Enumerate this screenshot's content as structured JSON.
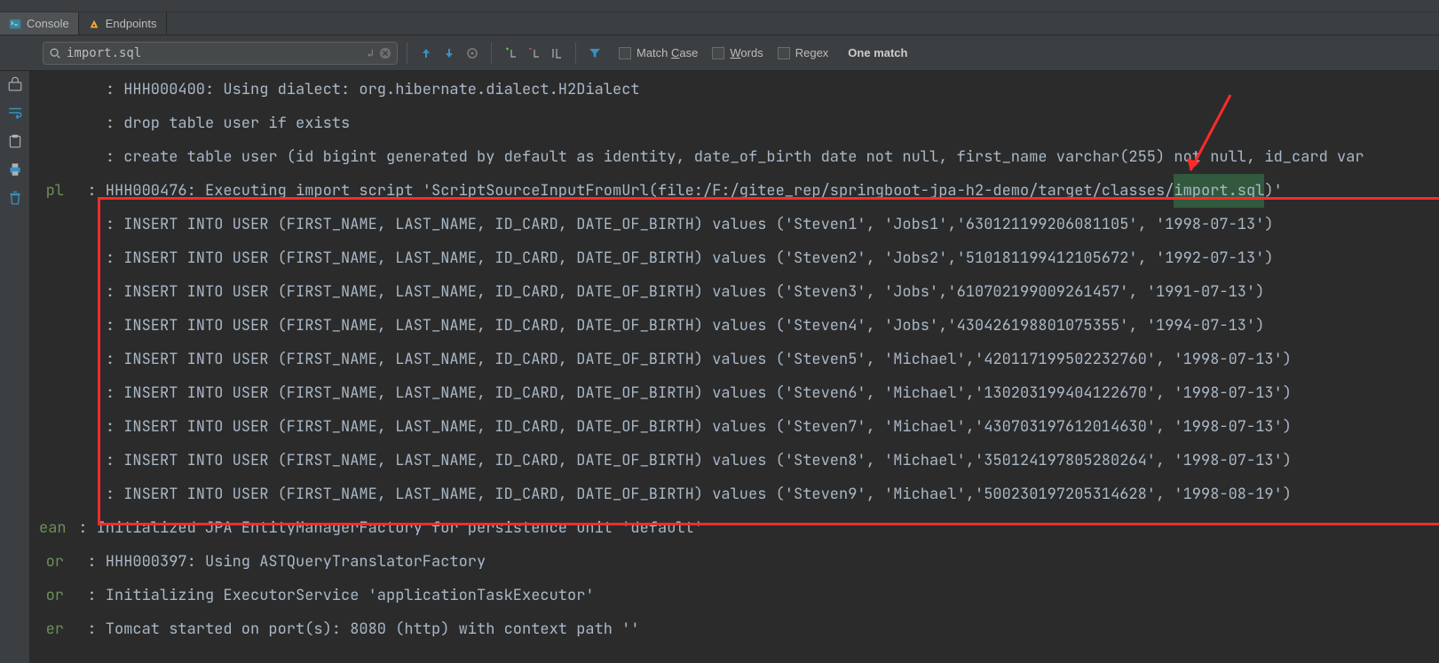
{
  "tabs": {
    "console": {
      "label": "Console"
    },
    "endpoints": {
      "label": "Endpoints"
    }
  },
  "search": {
    "value": "import.sql",
    "match_text": "One match"
  },
  "options": {
    "match_case_pre": "Match ",
    "match_case_u": "C",
    "match_case_post": "ase",
    "words_u": "W",
    "words_post": "ords",
    "regex": "Regex"
  },
  "leads": {
    "pl": "pl",
    "ean": "ean",
    "or": "or",
    "er": "er"
  },
  "lines": {
    "l0": ": HHH000400: Using dialect: org.hibernate.dialect.H2Dialect",
    "l1": ": drop table user if exists",
    "l2": ": create table user (id bigint generated by default as identity, date_of_birth date not null, first_name varchar(255) not null, id_card var",
    "l3a": "  : HHH000476: Executing import script 'ScriptSourceInputFromUrl(file:/F:/gitee_rep/springboot-jpa-h2-demo/target/classes/",
    "l3hl": "import.sql",
    "l3b": ")'",
    "l4": ": INSERT INTO USER (FIRST_NAME, LAST_NAME, ID_CARD, DATE_OF_BIRTH) values ('Steven1', 'Jobs1','630121199206081105', '1998-07-13')",
    "l5": ": INSERT INTO USER (FIRST_NAME, LAST_NAME, ID_CARD, DATE_OF_BIRTH) values ('Steven2', 'Jobs2','510181199412105672', '1992-07-13')",
    "l6": ": INSERT INTO USER (FIRST_NAME, LAST_NAME, ID_CARD, DATE_OF_BIRTH) values ('Steven3', 'Jobs','610702199009261457', '1991-07-13')",
    "l7": ": INSERT INTO USER (FIRST_NAME, LAST_NAME, ID_CARD, DATE_OF_BIRTH) values ('Steven4', 'Jobs','430426198801075355', '1994-07-13')",
    "l8": ": INSERT INTO USER (FIRST_NAME, LAST_NAME, ID_CARD, DATE_OF_BIRTH) values ('Steven5', 'Michael','420117199502232760', '1998-07-13')",
    "l9": ": INSERT INTO USER (FIRST_NAME, LAST_NAME, ID_CARD, DATE_OF_BIRTH) values ('Steven6', 'Michael','130203199404122670', '1998-07-13')",
    "l10": ": INSERT INTO USER (FIRST_NAME, LAST_NAME, ID_CARD, DATE_OF_BIRTH) values ('Steven7', 'Michael','430703197612014630', '1998-07-13')",
    "l11": ": INSERT INTO USER (FIRST_NAME, LAST_NAME, ID_CARD, DATE_OF_BIRTH) values ('Steven8', 'Michael','350124197805280264', '1998-07-13')",
    "l12": ": INSERT INTO USER (FIRST_NAME, LAST_NAME, ID_CARD, DATE_OF_BIRTH) values ('Steven9', 'Michael','500230197205314628', '1998-08-19')",
    "l13": " : Initialized JPA EntityManagerFactory for persistence unit 'default'",
    "l14": "  : HHH000397: Using ASTQueryTranslatorFactory",
    "l15": "  : Initializing ExecutorService 'applicationTaskExecutor'",
    "l16": "  : Tomcat started on port(s): 8080 (http) with context path ''"
  }
}
